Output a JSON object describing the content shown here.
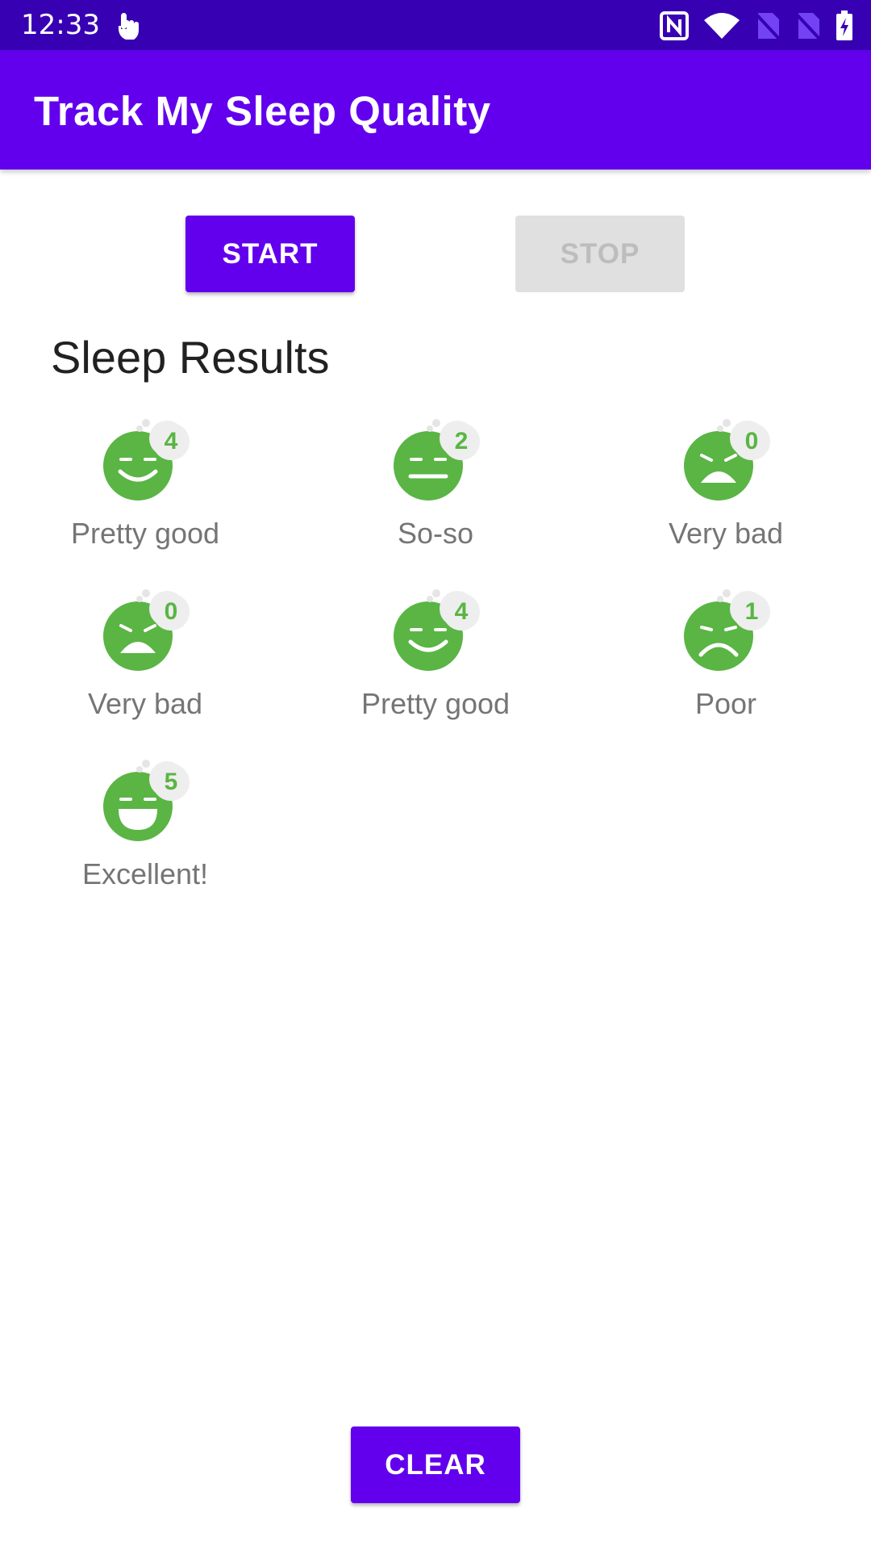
{
  "status_bar": {
    "time": "12:33",
    "icons": [
      "touch-icon",
      "nfc-icon",
      "wifi-icon",
      "no-sim-icon",
      "no-sim-icon",
      "battery-charging-icon"
    ]
  },
  "app_bar": {
    "title": "Track My Sleep Quality"
  },
  "controls": {
    "start_label": "START",
    "stop_label": "STOP",
    "clear_label": "CLEAR"
  },
  "section": {
    "title": "Sleep Results"
  },
  "results": [
    {
      "quality": "4",
      "label": "Pretty good",
      "face": "pretty-good-face-icon"
    },
    {
      "quality": "2",
      "label": "So-so",
      "face": "so-so-face-icon"
    },
    {
      "quality": "0",
      "label": "Very bad",
      "face": "very-bad-face-icon"
    },
    {
      "quality": "0",
      "label": "Very bad",
      "face": "very-bad-face-icon"
    },
    {
      "quality": "4",
      "label": "Pretty good",
      "face": "pretty-good-face-icon"
    },
    {
      "quality": "1",
      "label": "Poor",
      "face": "poor-face-icon"
    },
    {
      "quality": "5",
      "label": "Excellent!",
      "face": "excellent-face-icon"
    }
  ],
  "colors": {
    "status_bar": "#3700b3",
    "primary": "#6200ee",
    "face_green": "#5ab544",
    "disabled_bg": "#e0e0e0",
    "disabled_text": "#bdbdbd"
  }
}
